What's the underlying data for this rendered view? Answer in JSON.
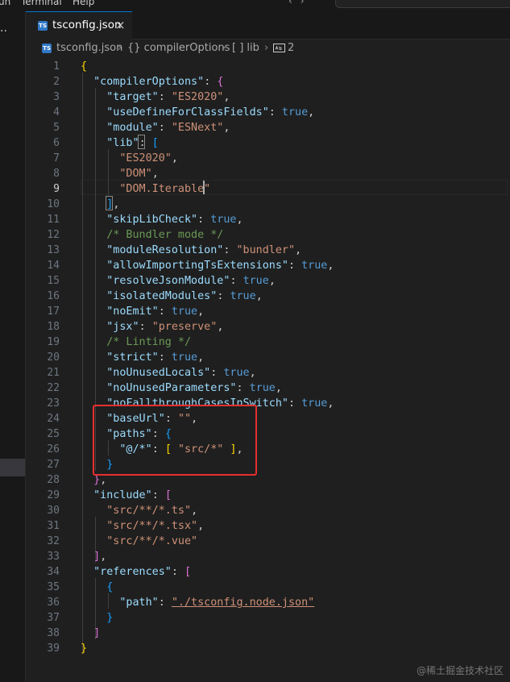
{
  "menu": {
    "items": [
      "un",
      "Terminal",
      "Help"
    ]
  },
  "tab": {
    "icon": "TS",
    "label": "tsconfig.json",
    "close": "×"
  },
  "breadcrumb": {
    "file_icon": "TS",
    "file": "tsconfig.json",
    "part1": "{} compilerOptions",
    "part2": "[ ] lib",
    "part3": "2",
    "separator": "›"
  },
  "editor": {
    "active_line": 9,
    "lines": [
      [
        [
          "{",
          "b1"
        ]
      ],
      [
        [
          "  ",
          "p"
        ],
        [
          "\"compilerOptions\"",
          "key"
        ],
        [
          ": ",
          "p"
        ],
        [
          "{",
          "b2"
        ]
      ],
      [
        [
          "    ",
          "p"
        ],
        [
          "\"target\"",
          "key"
        ],
        [
          ": ",
          "p"
        ],
        [
          "\"ES2020\"",
          "str"
        ],
        [
          ",",
          "p"
        ]
      ],
      [
        [
          "    ",
          "p"
        ],
        [
          "\"useDefineForClassFields\"",
          "key"
        ],
        [
          ": ",
          "p"
        ],
        [
          "true",
          "bool"
        ],
        [
          ",",
          "p"
        ]
      ],
      [
        [
          "    ",
          "p"
        ],
        [
          "\"module\"",
          "key"
        ],
        [
          ": ",
          "p"
        ],
        [
          "\"ESNext\"",
          "str"
        ],
        [
          ",",
          "p"
        ]
      ],
      [
        [
          "    ",
          "p"
        ],
        [
          "\"lib\"",
          "key"
        ],
        [
          ": ",
          "p"
        ],
        [
          "[",
          "b3"
        ]
      ],
      [
        [
          "      ",
          "p"
        ],
        [
          "\"ES2020\"",
          "str"
        ],
        [
          ",",
          "p"
        ]
      ],
      [
        [
          "      ",
          "p"
        ],
        [
          "\"DOM\"",
          "str"
        ],
        [
          ",",
          "p"
        ]
      ],
      [
        [
          "      ",
          "p"
        ],
        [
          "\"DOM.Iterable\"",
          "str"
        ]
      ],
      [
        [
          "    ",
          "p"
        ],
        [
          "]",
          "b3"
        ],
        [
          ",",
          "p"
        ]
      ],
      [
        [
          "    ",
          "p"
        ],
        [
          "\"skipLibCheck\"",
          "key"
        ],
        [
          ": ",
          "p"
        ],
        [
          "true",
          "bool"
        ],
        [
          ",",
          "p"
        ]
      ],
      [
        [
          "    ",
          "p"
        ],
        [
          "/* Bundler mode */",
          "cmt"
        ]
      ],
      [
        [
          "    ",
          "p"
        ],
        [
          "\"moduleResolution\"",
          "key"
        ],
        [
          ": ",
          "p"
        ],
        [
          "\"bundler\"",
          "str"
        ],
        [
          ",",
          "p"
        ]
      ],
      [
        [
          "    ",
          "p"
        ],
        [
          "\"allowImportingTsExtensions\"",
          "key"
        ],
        [
          ": ",
          "p"
        ],
        [
          "true",
          "bool"
        ],
        [
          ",",
          "p"
        ]
      ],
      [
        [
          "    ",
          "p"
        ],
        [
          "\"resolveJsonModule\"",
          "key"
        ],
        [
          ": ",
          "p"
        ],
        [
          "true",
          "bool"
        ],
        [
          ",",
          "p"
        ]
      ],
      [
        [
          "    ",
          "p"
        ],
        [
          "\"isolatedModules\"",
          "key"
        ],
        [
          ": ",
          "p"
        ],
        [
          "true",
          "bool"
        ],
        [
          ",",
          "p"
        ]
      ],
      [
        [
          "    ",
          "p"
        ],
        [
          "\"noEmit\"",
          "key"
        ],
        [
          ": ",
          "p"
        ],
        [
          "true",
          "bool"
        ],
        [
          ",",
          "p"
        ]
      ],
      [
        [
          "    ",
          "p"
        ],
        [
          "\"jsx\"",
          "key"
        ],
        [
          ": ",
          "p"
        ],
        [
          "\"preserve\"",
          "str"
        ],
        [
          ",",
          "p"
        ]
      ],
      [
        [
          "    ",
          "p"
        ],
        [
          "/* Linting */",
          "cmt"
        ]
      ],
      [
        [
          "    ",
          "p"
        ],
        [
          "\"strict\"",
          "key"
        ],
        [
          ": ",
          "p"
        ],
        [
          "true",
          "bool"
        ],
        [
          ",",
          "p"
        ]
      ],
      [
        [
          "    ",
          "p"
        ],
        [
          "\"noUnusedLocals\"",
          "key"
        ],
        [
          ": ",
          "p"
        ],
        [
          "true",
          "bool"
        ],
        [
          ",",
          "p"
        ]
      ],
      [
        [
          "    ",
          "p"
        ],
        [
          "\"noUnusedParameters\"",
          "key"
        ],
        [
          ": ",
          "p"
        ],
        [
          "true",
          "bool"
        ],
        [
          ",",
          "p"
        ]
      ],
      [
        [
          "    ",
          "p"
        ],
        [
          "\"noFallthroughCasesInSwitch\"",
          "key"
        ],
        [
          ": ",
          "p"
        ],
        [
          "true",
          "bool"
        ],
        [
          ",",
          "p"
        ]
      ],
      [
        [
          "    ",
          "p"
        ],
        [
          "\"baseUrl\"",
          "key"
        ],
        [
          ": ",
          "p"
        ],
        [
          "\"\"",
          "str"
        ],
        [
          ",",
          "p"
        ]
      ],
      [
        [
          "    ",
          "p"
        ],
        [
          "\"paths\"",
          "key"
        ],
        [
          ": ",
          "p"
        ],
        [
          "{",
          "b3"
        ]
      ],
      [
        [
          "      ",
          "p"
        ],
        [
          "\"@/*\"",
          "key"
        ],
        [
          ": ",
          "p"
        ],
        [
          "[",
          "b1"
        ],
        [
          " ",
          "p"
        ],
        [
          "\"src/*\"",
          "str"
        ],
        [
          " ",
          "p"
        ],
        [
          "]",
          "b1"
        ],
        [
          ",",
          "p"
        ]
      ],
      [
        [
          "    ",
          "p"
        ],
        [
          "}",
          "b3"
        ]
      ],
      [
        [
          "  ",
          "p"
        ],
        [
          "}",
          "b2"
        ],
        [
          ",",
          "p"
        ]
      ],
      [
        [
          "  ",
          "p"
        ],
        [
          "\"include\"",
          "key"
        ],
        [
          ": ",
          "p"
        ],
        [
          "[",
          "b2"
        ]
      ],
      [
        [
          "    ",
          "p"
        ],
        [
          "\"src/**/*.ts\"",
          "str"
        ],
        [
          ",",
          "p"
        ]
      ],
      [
        [
          "    ",
          "p"
        ],
        [
          "\"src/**/*.tsx\"",
          "str"
        ],
        [
          ",",
          "p"
        ]
      ],
      [
        [
          "    ",
          "p"
        ],
        [
          "\"src/**/*.vue\"",
          "str"
        ]
      ],
      [
        [
          "  ",
          "p"
        ],
        [
          "]",
          "b2"
        ],
        [
          ",",
          "p"
        ]
      ],
      [
        [
          "  ",
          "p"
        ],
        [
          "\"references\"",
          "key"
        ],
        [
          ": ",
          "p"
        ],
        [
          "[",
          "b2"
        ]
      ],
      [
        [
          "    ",
          "p"
        ],
        [
          "{",
          "b3"
        ]
      ],
      [
        [
          "      ",
          "p"
        ],
        [
          "\"path\"",
          "key"
        ],
        [
          ": ",
          "p"
        ],
        [
          "\"./tsconfig.node.json\"",
          "str link"
        ]
      ],
      [
        [
          "    ",
          "p"
        ],
        [
          "}",
          "b3"
        ]
      ],
      [
        [
          "  ",
          "p"
        ],
        [
          "]",
          "b2"
        ]
      ],
      [
        [
          "}",
          "b1"
        ]
      ]
    ]
  },
  "watermark": "@稀土掘金技术社区",
  "colors": {
    "background": "#1f1f1f",
    "key": "#9cdcfe",
    "string": "#ce9178",
    "boolean": "#569cd6",
    "comment": "#6a9955",
    "annotation": "#e5302f"
  },
  "icons": {
    "more": "ellipsis-icon",
    "close": "close-icon",
    "file": "typescript-file-icon",
    "string_symbol": "string-symbol-icon"
  }
}
